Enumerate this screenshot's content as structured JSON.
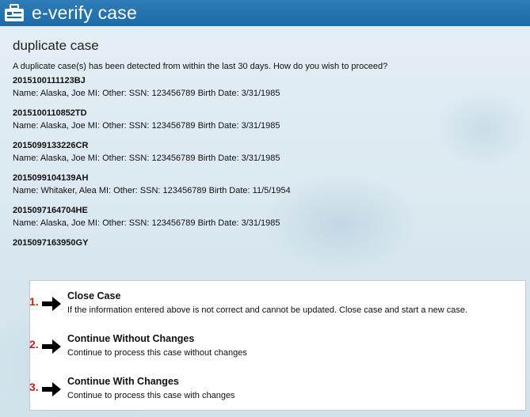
{
  "header": {
    "title": "e-verify case",
    "icon": "id-card-icon"
  },
  "page": {
    "title": "duplicate case",
    "question": "A duplicate case(s) has been detected from within the last 30 days. How do you wish to proceed?"
  },
  "cases": [
    {
      "id": "2015100111123BJ",
      "details": "Name: Alaska, Joe MI:  Other:  SSN: 123456789 Birth Date: 3/31/1985"
    },
    {
      "id": "2015100110852TD",
      "details": "Name: Alaska, Joe MI:  Other:  SSN: 123456789 Birth Date: 3/31/1985"
    },
    {
      "id": "2015099133226CR",
      "details": "Name: Alaska, Joe MI:  Other:  SSN: 123456789 Birth Date: 3/31/1985"
    },
    {
      "id": "2015099104139AH",
      "details": "Name: Whitaker, Alea MI:  Other:  SSN: 123456789 Birth Date: 11/5/1954"
    },
    {
      "id": "2015097164704HE",
      "details": "Name: Alaska, Joe MI:  Other:  SSN: 123456789 Birth Date: 3/31/1985"
    },
    {
      "id": "2015097163950GY",
      "details": ""
    }
  ],
  "options": [
    {
      "number": "1.",
      "title": "Close Case",
      "description": "If the information entered above is not correct and cannot be updated. Close case and start a new case."
    },
    {
      "number": "2.",
      "title": "Continue Without Changes",
      "description": "Continue to process this case without changes"
    },
    {
      "number": "3.",
      "title": "Continue With Changes",
      "description": "Continue to process this case with changes"
    }
  ],
  "colors": {
    "header": "#1d6aa6",
    "option_number": "#d11a1a",
    "background": "#d7e6ee"
  }
}
